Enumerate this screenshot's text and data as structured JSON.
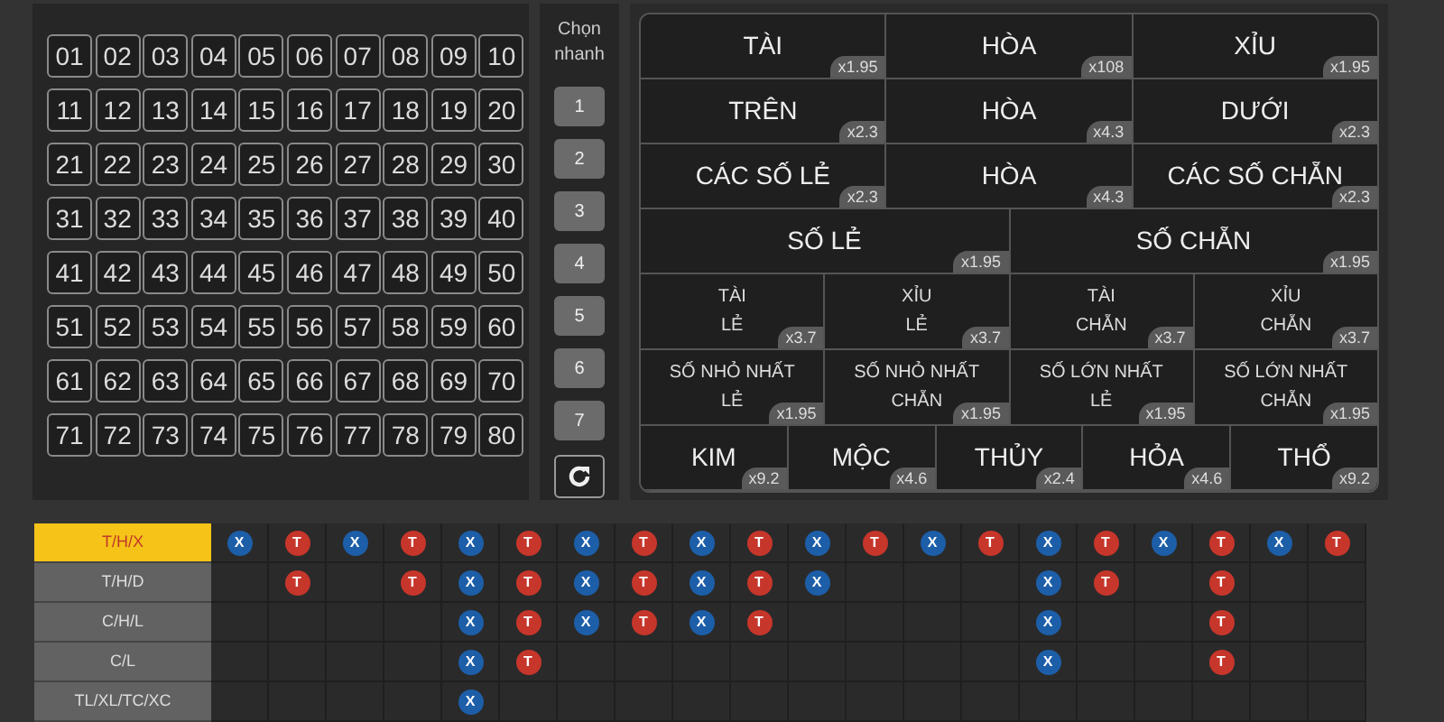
{
  "numbers": [
    "01",
    "02",
    "03",
    "04",
    "05",
    "06",
    "07",
    "08",
    "09",
    "10",
    "11",
    "12",
    "13",
    "14",
    "15",
    "16",
    "17",
    "18",
    "19",
    "20",
    "21",
    "22",
    "23",
    "24",
    "25",
    "26",
    "27",
    "28",
    "29",
    "30",
    "31",
    "32",
    "33",
    "34",
    "35",
    "36",
    "37",
    "38",
    "39",
    "40",
    "41",
    "42",
    "43",
    "44",
    "45",
    "46",
    "47",
    "48",
    "49",
    "50",
    "51",
    "52",
    "53",
    "54",
    "55",
    "56",
    "57",
    "58",
    "59",
    "60",
    "61",
    "62",
    "63",
    "64",
    "65",
    "66",
    "67",
    "68",
    "69",
    "70",
    "71",
    "72",
    "73",
    "74",
    "75",
    "76",
    "77",
    "78",
    "79",
    "80"
  ],
  "quick_pick": {
    "label": "Chọn nhanh",
    "buttons": [
      "1",
      "2",
      "3",
      "4",
      "5",
      "6",
      "7"
    ]
  },
  "bet_rows": [
    {
      "cells": [
        {
          "lines": [
            "TÀI"
          ],
          "odds": "x1.95"
        },
        {
          "lines": [
            "HÒA"
          ],
          "odds": "x108"
        },
        {
          "lines": [
            "XỈU"
          ],
          "odds": "x1.95"
        }
      ]
    },
    {
      "cells": [
        {
          "lines": [
            "TRÊN"
          ],
          "odds": "x2.3"
        },
        {
          "lines": [
            "HÒA"
          ],
          "odds": "x4.3"
        },
        {
          "lines": [
            "DƯỚI"
          ],
          "odds": "x2.3"
        }
      ]
    },
    {
      "cells": [
        {
          "lines": [
            "CÁC SỐ LẺ"
          ],
          "odds": "x2.3"
        },
        {
          "lines": [
            "HÒA"
          ],
          "odds": "x4.3"
        },
        {
          "lines": [
            "CÁC SỐ CHẴN"
          ],
          "odds": "x2.3"
        }
      ]
    },
    {
      "cells": [
        {
          "lines": [
            "SỐ LẺ"
          ],
          "odds": "x1.95"
        },
        {
          "lines": [
            "SỐ CHẴN"
          ],
          "odds": "x1.95"
        }
      ]
    },
    {
      "cells": [
        {
          "lines": [
            "TÀI",
            "LẺ"
          ],
          "odds": "x3.7"
        },
        {
          "lines": [
            "XỈU",
            "LẺ"
          ],
          "odds": "x3.7"
        },
        {
          "lines": [
            "TÀI",
            "CHẴN"
          ],
          "odds": "x3.7"
        },
        {
          "lines": [
            "XỈU",
            "CHẴN"
          ],
          "odds": "x3.7"
        }
      ]
    },
    {
      "cells": [
        {
          "lines": [
            "SỐ NHỎ NHẤT",
            "LẺ"
          ],
          "odds": "x1.95"
        },
        {
          "lines": [
            "SỐ NHỎ NHẤT",
            "CHẴN"
          ],
          "odds": "x1.95"
        },
        {
          "lines": [
            "SỐ LỚN NHẤT",
            "LẺ"
          ],
          "odds": "x1.95"
        },
        {
          "lines": [
            "SỐ LỚN NHẤT",
            "CHẴN"
          ],
          "odds": "x1.95"
        }
      ]
    },
    {
      "cells": [
        {
          "lines": [
            "KIM"
          ],
          "odds": "x9.2"
        },
        {
          "lines": [
            "MỘC"
          ],
          "odds": "x4.6"
        },
        {
          "lines": [
            "THỦY"
          ],
          "odds": "x2.4"
        },
        {
          "lines": [
            "HỎA"
          ],
          "odds": "x4.6"
        },
        {
          "lines": [
            "THỔ"
          ],
          "odds": "x9.2"
        }
      ]
    }
  ],
  "history": [
    {
      "label": "T/H/X",
      "selected": true,
      "cells": [
        "X",
        "T",
        "X",
        "T",
        "X",
        "T",
        "X",
        "T",
        "X",
        "T",
        "X",
        "T",
        "X",
        "T",
        "X",
        "T",
        "X",
        "T",
        "X",
        "T"
      ]
    },
    {
      "label": "T/H/D",
      "selected": false,
      "cells": [
        null,
        "T",
        null,
        "T",
        "X",
        "T",
        "X",
        "T",
        "X",
        "T",
        "X",
        null,
        null,
        null,
        "X",
        "T",
        null,
        "T",
        null,
        null
      ]
    },
    {
      "label": "C/H/L",
      "selected": false,
      "cells": [
        null,
        null,
        null,
        null,
        "X",
        "T",
        "X",
        "T",
        "X",
        "T",
        null,
        null,
        null,
        null,
        "X",
        null,
        null,
        "T",
        null,
        null
      ]
    },
    {
      "label": "C/L",
      "selected": false,
      "cells": [
        null,
        null,
        null,
        null,
        "X",
        "T",
        null,
        null,
        null,
        null,
        null,
        null,
        null,
        null,
        "X",
        null,
        null,
        "T",
        null,
        null
      ]
    },
    {
      "label": "TL/XL/TC/XC",
      "selected": false,
      "cells": [
        null,
        null,
        null,
        null,
        "X",
        null,
        null,
        null,
        null,
        null,
        null,
        null,
        null,
        null,
        null,
        null,
        null,
        null,
        null,
        null
      ]
    }
  ]
}
